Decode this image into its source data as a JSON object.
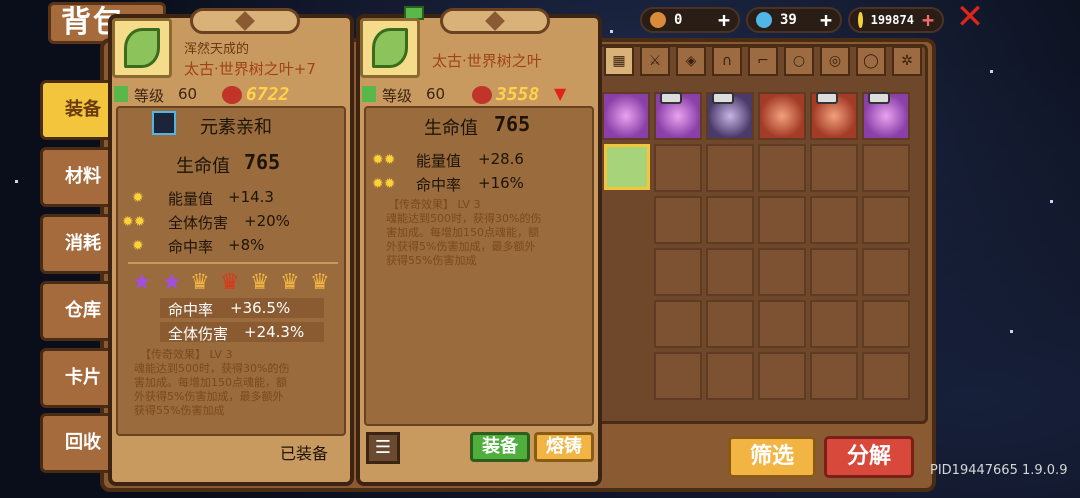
{
  "header": {
    "title": "背包",
    "resources": [
      {
        "icon": "bottle-icon",
        "value": "0"
      },
      {
        "icon": "gem-icon",
        "value": "39"
      },
      {
        "icon": "gold-coin-icon",
        "value": "199874"
      }
    ]
  },
  "sidebar": {
    "items": [
      {
        "label": "装备"
      },
      {
        "label": "材料"
      },
      {
        "label": "消耗品"
      },
      {
        "label": "仓库"
      },
      {
        "label": "卡片"
      },
      {
        "label": "回收站"
      }
    ]
  },
  "tooltip_equipped": {
    "prefix": "浑然天成的",
    "name": "太古·世界树之叶+7",
    "level_label": "等级",
    "level": "60",
    "power": "6722",
    "element_affinity": "元素亲和",
    "main_stat_label": "生命值",
    "main_stat_value": "765",
    "stats": [
      {
        "label": "能量值",
        "value": "+14.3"
      },
      {
        "label": "全体伤害",
        "value": "+20%"
      },
      {
        "label": "命中率",
        "value": "+8%"
      }
    ],
    "star_bonus": [
      {
        "label": "命中率",
        "value": "+36.5%"
      },
      {
        "label": "全体伤害",
        "value": "+24.3%"
      }
    ],
    "legend_title": "【传奇效果】 LV 3",
    "legend_desc": [
      "魂能达到500时，获得30%的伤",
      "害加成。每增加150点魂能，额",
      "外获得5%伤害加成，最多额外",
      "获得55%伤害加成"
    ],
    "status": "已装备",
    "ranks": {
      "stars": 2,
      "crowns": 5
    }
  },
  "tooltip_compare": {
    "name": "太古·世界树之叶",
    "level_label": "等级",
    "level": "60",
    "power": "3558",
    "main_stat_label": "生命值",
    "main_stat_value": "765",
    "stats": [
      {
        "label": "能量值",
        "value": "+28.6"
      },
      {
        "label": "命中率",
        "value": "+16%"
      }
    ],
    "legend_title": "【传奇效果】 LV 3",
    "legend_desc": [
      "魂能达到500时，获得30%的伤",
      "害加成。每增加150点魂能，额",
      "外获得5%伤害加成，最多额外",
      "获得55%伤害加成"
    ],
    "equip_label": "装备",
    "forge_label": "熔铸"
  },
  "buttons": {
    "filter": "筛选",
    "decompose": "分解"
  },
  "footer": {
    "pid": "PID19447665 1.9.0.9"
  },
  "colors": {
    "panel": "#8a5a33",
    "accent_gold": "#f2c53d",
    "decompose_red": "#d9493b",
    "equip_green": "#4fae3c",
    "forge_orange": "#f2b544"
  }
}
